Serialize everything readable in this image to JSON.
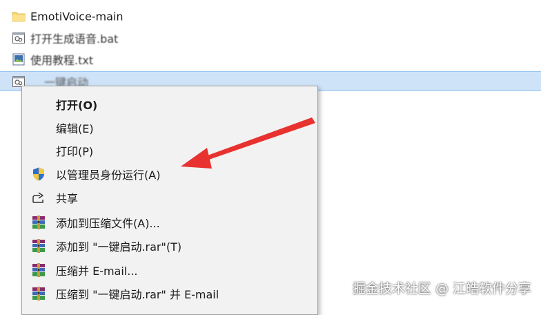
{
  "files": [
    {
      "name": "EmotiVoice-main",
      "icon": "folder-icon"
    },
    {
      "name": "打开生成语音.bat",
      "icon": "batch-file-icon"
    },
    {
      "name": "使用教程.txt",
      "icon": "image-file-icon"
    },
    {
      "name": "一键启动",
      "icon": "batch-file-icon"
    }
  ],
  "context_menu": {
    "items": [
      {
        "label": "打开(O)",
        "icon": ""
      },
      {
        "label": "编辑(E)",
        "icon": ""
      },
      {
        "label": "打印(P)",
        "icon": ""
      },
      {
        "label": "以管理员身份运行(A)",
        "icon": "uac-shield-icon"
      },
      {
        "label": "共享",
        "icon": "share-icon"
      },
      {
        "label": "添加到压缩文件(A)...",
        "icon": "winrar-icon"
      },
      {
        "label": "添加到 \"一键启动.rar\"(T)",
        "icon": "winrar-icon"
      },
      {
        "label": "压缩并 E-mail...",
        "icon": "winrar-icon"
      },
      {
        "label": "压缩到 \"一键启动.rar\" 并 E-mail",
        "icon": "winrar-icon"
      }
    ]
  },
  "watermark": "掘金技术社区 @ 江皓软件分享",
  "colors": {
    "selection": "#cfe3f8",
    "menu_bg": "#f2f2f2",
    "arrow": "#e8322f"
  }
}
